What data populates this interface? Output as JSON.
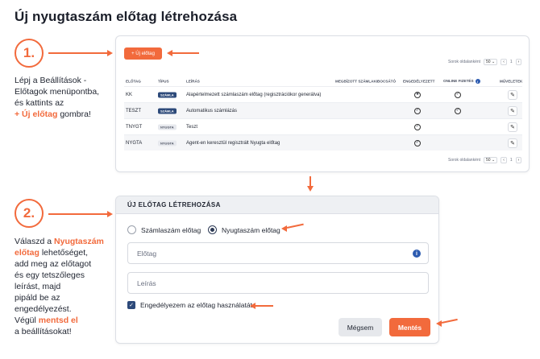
{
  "page": {
    "title": "Új nyugtaszám előtag létrehozása"
  },
  "colors": {
    "accent": "#f26a3c",
    "navy": "#2d4a7a",
    "info": "#2d5bb0"
  },
  "step1": {
    "number": "1.",
    "text_a": "Lépj a Beállítások -",
    "text_b": "Előtagok menüpontba,",
    "text_c": "és kattints az",
    "text_hl": "+ Új előtag",
    "text_d": "gombra!"
  },
  "step2": {
    "number": "2.",
    "l1a": "Válaszd a ",
    "l1hl": "Nyugtaszám",
    "l2hl": "előtag",
    "l2b": " lehetőséget,",
    "l3": "add meg az előtagot",
    "l4": "és egy tetszőleges",
    "l5": "leírást, majd",
    "l6": "pipáld be az",
    "l7": "engedélyezést.",
    "l8a": "Végül ",
    "l8hl": "mentsd el",
    "l9": "a beállításokat!"
  },
  "panel1": {
    "new_button": "+ Új előtag",
    "pager_label": "Sorok oldalanként",
    "per_page": "50",
    "page_prev": "‹",
    "page_num": "1",
    "page_next": "›",
    "columns": {
      "prefix": "ELŐTAG",
      "type": "TÍPUS",
      "desc": "LEÍRÁS",
      "issuer": "MEGBÍZOTT SZÁMLAKIBOCSÁTÓ",
      "enabled": "ENGEDÉLYEZETT",
      "online": "ONLINE FIZETÉS",
      "actions": "MŰVELETEK"
    },
    "rows": [
      {
        "prefix": "KK",
        "type": "SZÁMLA",
        "desc": "Alapértelmezett számlaszám előtag (regisztrációkor generálva)",
        "enabled": "star",
        "online": "check"
      },
      {
        "prefix": "TESZT",
        "type": "SZÁMLA",
        "desc": "Automatikus számlázás",
        "enabled": "check",
        "online": "check"
      },
      {
        "prefix": "TNYGT",
        "type": "NYUGTA",
        "desc": "Teszt",
        "enabled": "check",
        "online": ""
      },
      {
        "prefix": "NYGTA",
        "type": "NYUGTA",
        "desc": "Agent-en keresztül regisztrált Nyugta előtag",
        "enabled": "check",
        "online": ""
      }
    ]
  },
  "panel2": {
    "header": "ÚJ ELŐTAG LÉTREHOZÁSA",
    "radio_invoice": "Számlaszám előtag",
    "radio_receipt": "Nyugtaszám előtag",
    "selected": "Nyugtaszám előtag",
    "prefix_placeholder": "Előtag",
    "desc_placeholder": "Leírás",
    "enable_label": "Engedélyezem az előtag használatát",
    "enable_checked": true,
    "cancel": "Mégsem",
    "save": "Mentés"
  }
}
